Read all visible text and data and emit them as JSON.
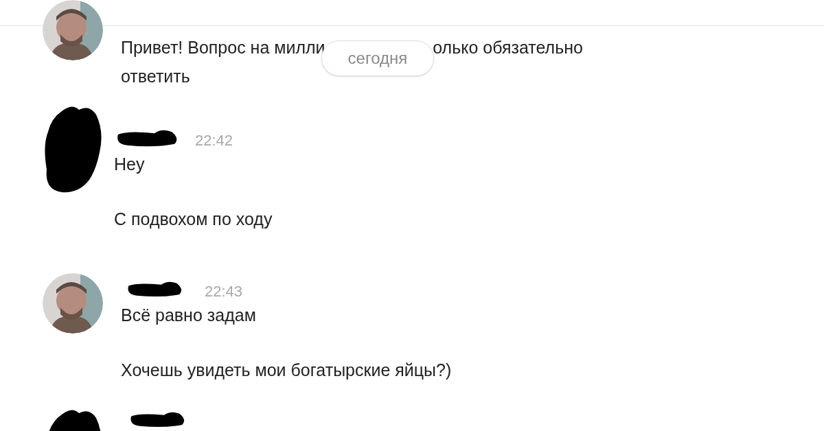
{
  "date_badge": "сегодня",
  "groups": [
    {
      "header": false,
      "messages": [
        {
          "kind": "covered",
          "left": "Привет! Вопрос на милли",
          "right": "олько обязательно",
          "next_line": "ответить"
        }
      ]
    },
    {
      "kind": "redacted",
      "header": true,
      "time": "22:42",
      "messages": [
        {
          "kind": "plain",
          "text": "Hey"
        },
        {
          "kind": "plain",
          "text": "С подвохом по ходу"
        }
      ]
    },
    {
      "header": true,
      "time": "22:43",
      "messages": [
        {
          "kind": "plain",
          "text": "Всё равно задам"
        },
        {
          "kind": "plain",
          "text": "Хочешь увидеть мои богатырские яйцы?)"
        }
      ]
    },
    {
      "kind": "redacted",
      "header": true
    }
  ]
}
